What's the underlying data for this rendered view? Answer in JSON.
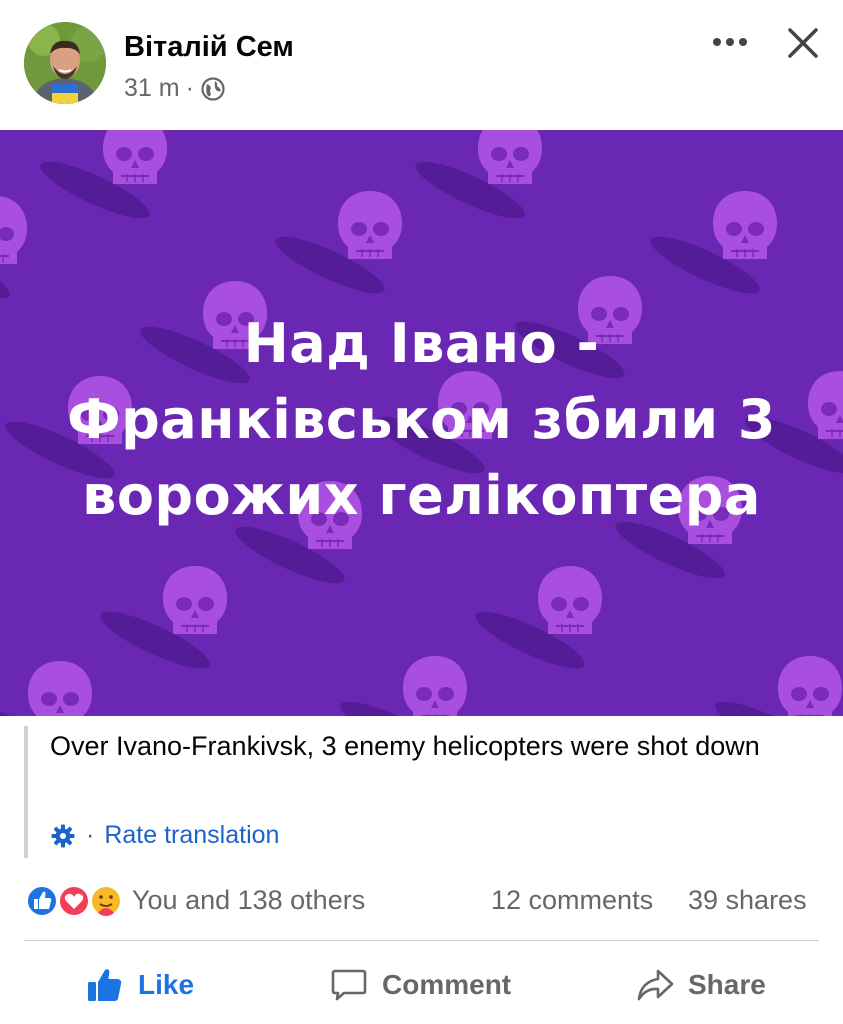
{
  "post": {
    "author": "Віталій Сем",
    "time": "31 m",
    "separator": "·",
    "privacy_icon": "globe-icon",
    "more_icon": "more-icon",
    "close_icon": "close-icon"
  },
  "media": {
    "headline": "Над Івано - Франківськом збили 3 ворожих гелікоптера",
    "background_color": "#6a27b4",
    "pattern_color": "#9b3fd6"
  },
  "translation": {
    "text": "Over Ivano-Frankivsk, 3 enemy helicopters were shot down",
    "separator": "·",
    "rate_label": "Rate translation",
    "settings_icon": "gear-icon"
  },
  "engagement": {
    "reactions": [
      "like-reaction-icon",
      "love-reaction-icon",
      "care-reaction-icon"
    ],
    "reaction_summary": "You and 138 others",
    "comments": "12 comments",
    "shares": "39 shares"
  },
  "actions": {
    "like_label": "Like",
    "comment_label": "Comment",
    "share_label": "Share"
  },
  "colors": {
    "accent": "#1b74e4",
    "link": "#1b64c8",
    "muted": "#65676b"
  }
}
